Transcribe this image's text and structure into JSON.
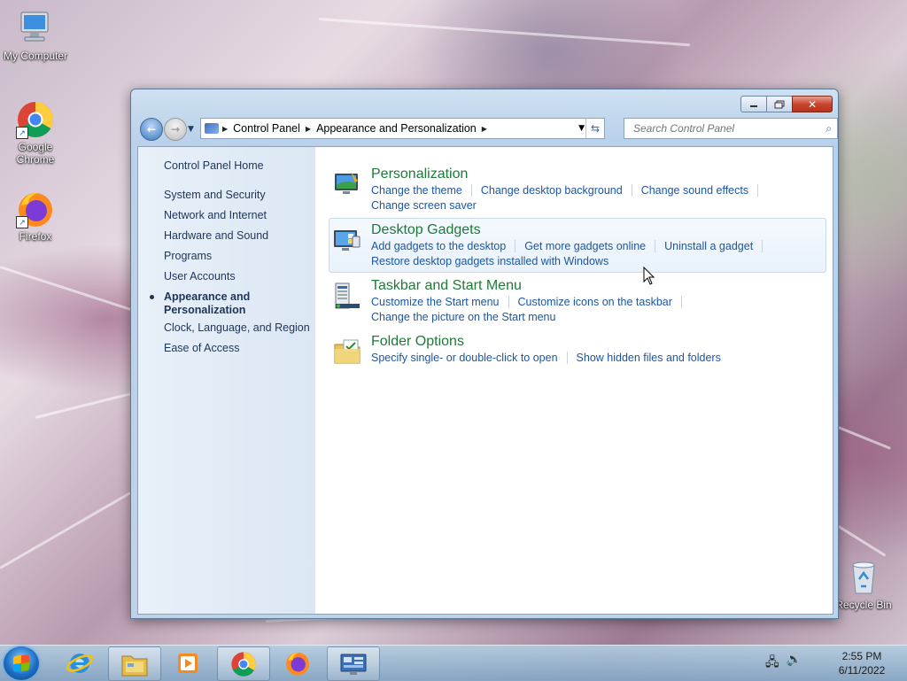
{
  "desktop": {
    "icons": [
      {
        "label": "My Computer",
        "icon": "computer-icon"
      },
      {
        "label": "Google Chrome",
        "icon": "chrome-icon"
      },
      {
        "label": "Firefox",
        "icon": "firefox-icon"
      },
      {
        "label": "Recycle Bin",
        "icon": "recycle-bin-icon"
      }
    ]
  },
  "window": {
    "address": {
      "crumbs": [
        "Control Panel",
        "Appearance and Personalization"
      ]
    },
    "search": {
      "placeholder": "Search Control Panel"
    },
    "sidebar": {
      "home": "Control Panel Home",
      "items": [
        {
          "label": "System and Security"
        },
        {
          "label": "Network and Internet"
        },
        {
          "label": "Hardware and Sound"
        },
        {
          "label": "Programs"
        },
        {
          "label": "User Accounts"
        },
        {
          "label": "Appearance and Personalization",
          "line1": "Appearance and",
          "line2": "Personalization",
          "active": true
        },
        {
          "label": "Clock, Language, and Region"
        },
        {
          "label": "Ease of Access"
        }
      ]
    },
    "categories": [
      {
        "title": "Personalization",
        "icon": "personalization-icon",
        "links": [
          "Change the theme",
          "Change desktop background",
          "Change sound effects",
          "Change screen saver"
        ]
      },
      {
        "title": "Desktop Gadgets",
        "icon": "desktop-gadgets-icon",
        "hover": true,
        "links": [
          "Add gadgets to the desktop",
          "Get more gadgets online",
          "Uninstall a gadget",
          "Restore desktop gadgets installed with Windows"
        ]
      },
      {
        "title": "Taskbar and Start Menu",
        "icon": "taskbar-icon",
        "links": [
          "Customize the Start menu",
          "Customize icons on the taskbar",
          "Change the picture on the Start menu"
        ]
      },
      {
        "title": "Folder Options",
        "icon": "folder-options-icon",
        "links": [
          "Specify single- or double-click to open",
          "Show hidden files and folders"
        ]
      }
    ]
  },
  "taskbar": {
    "buttons": [
      {
        "icon": "internet-explorer-icon"
      },
      {
        "icon": "windows-explorer-icon"
      },
      {
        "icon": "media-player-icon"
      },
      {
        "icon": "chrome-icon"
      },
      {
        "icon": "firefox-icon"
      },
      {
        "icon": "control-panel-icon"
      }
    ],
    "clock": {
      "time": "2:55 PM",
      "date": "6/11/2022"
    }
  },
  "colors": {
    "link": "#1c56a4",
    "category_title": "#1e7a36",
    "sidebar_text": "#1e3558"
  }
}
